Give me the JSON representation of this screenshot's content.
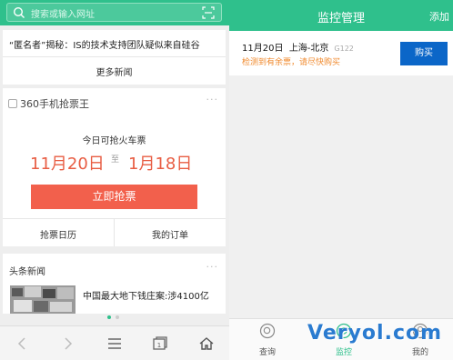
{
  "browser": {
    "search_placeholder": "搜索或输入网址",
    "news_card": {
      "headline": "“匿名者”揭秘：IS的技术支持团队疑似来自硅谷",
      "more": "更多新闻"
    },
    "ticket_card": {
      "title": "360手机抢票王",
      "subtitle": "今日可抢火车票",
      "from_date": "11月20日",
      "to_word": "至",
      "to_date": "1月18日",
      "grab_button": "立即抢票",
      "calendar": "抢票日历",
      "orders": "我的订单"
    },
    "headlines_card": {
      "title": "头条新闻",
      "item": "中国最大地下钱庄案:涉4100亿"
    },
    "page_indicator": {
      "count": 2,
      "active": 0,
      "active_color": "#2fc08c",
      "inactive_color": "#cccccc"
    }
  },
  "monitor": {
    "title": "监控管理",
    "add": "添加",
    "item": {
      "date": "11月20日",
      "route": "上海-北京",
      "train": "G122",
      "status": "检测到有余票，请尽快购买",
      "buy": "购买"
    },
    "tabs": [
      {
        "label": "查询",
        "icon": "search-icon",
        "active": false
      },
      {
        "label": "监控",
        "icon": "monitor-icon",
        "active": true
      },
      {
        "label": "我的",
        "icon": "user-icon",
        "active": false
      }
    ]
  },
  "watermark": "Veryol.com",
  "colors": {
    "brand_green": "#2fc08c",
    "accent_red": "#e85d43",
    "button_red": "#f2604c",
    "buy_blue": "#0b66c8",
    "warning_orange": "#f08a2e"
  }
}
